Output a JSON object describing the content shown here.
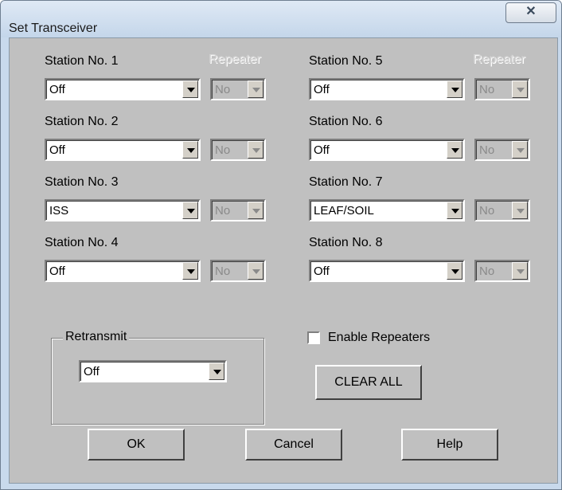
{
  "window": {
    "title": "Set Transceiver",
    "close_icon": "close-icon"
  },
  "stations": [
    {
      "label": "Station No. 1",
      "value": "Off",
      "repeater": "No"
    },
    {
      "label": "Station No. 2",
      "value": "Off",
      "repeater": "No"
    },
    {
      "label": "Station No. 3",
      "value": "ISS",
      "repeater": "No"
    },
    {
      "label": "Station No. 4",
      "value": "Off",
      "repeater": "No"
    },
    {
      "label": "Station No. 5",
      "value": "Off",
      "repeater": "No"
    },
    {
      "label": "Station No. 6",
      "value": "Off",
      "repeater": "No"
    },
    {
      "label": "Station No. 7",
      "value": "LEAF/SOIL",
      "repeater": "No"
    },
    {
      "label": "Station No. 8",
      "value": "Off",
      "repeater": "No"
    }
  ],
  "repeater_header": "Repeater",
  "retransmit": {
    "label": "Retransmit",
    "value": "Off"
  },
  "enable_repeaters": {
    "label": "Enable Repeaters",
    "checked": false
  },
  "buttons": {
    "clear_all": "CLEAR ALL",
    "ok": "OK",
    "cancel": "Cancel",
    "help": "Help"
  }
}
